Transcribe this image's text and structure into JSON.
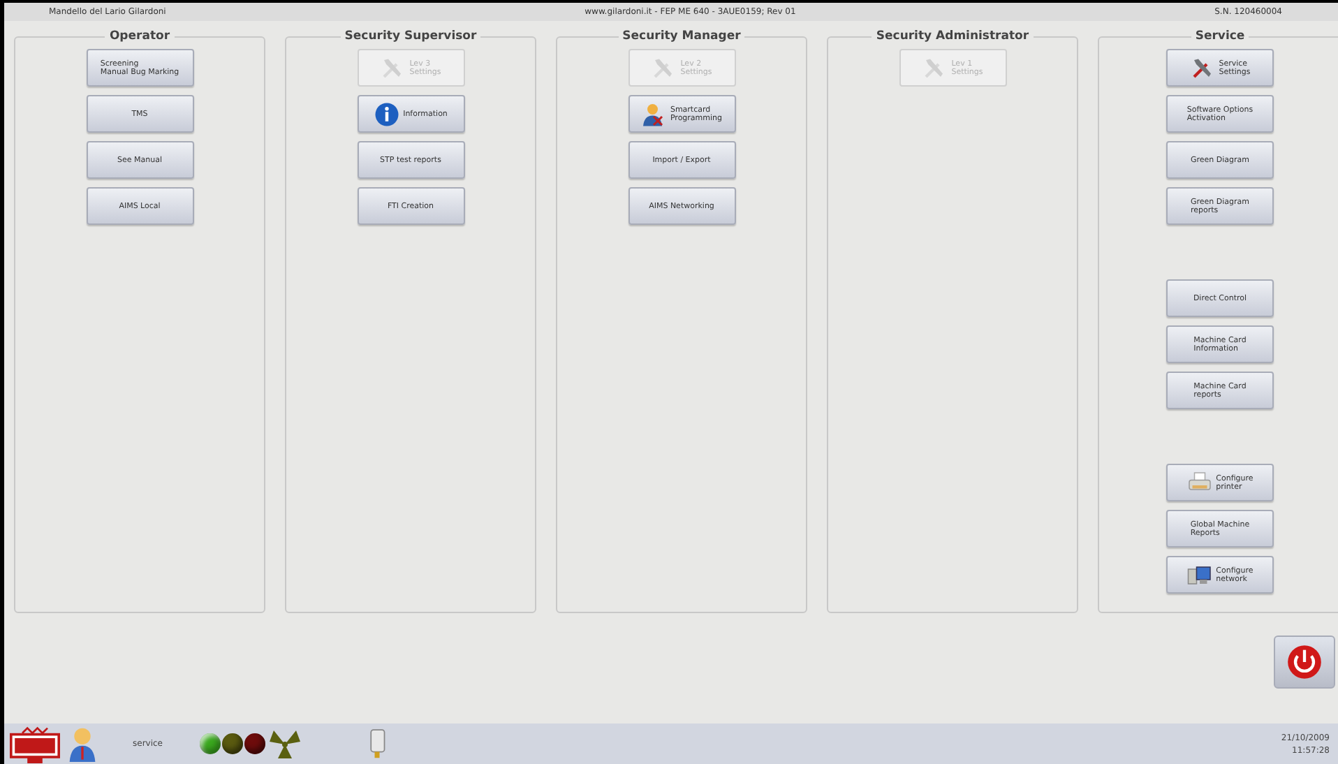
{
  "header": {
    "left": "Mandello del Lario Gilardoni",
    "center": "www.gilardoni.it - FEP ME 640 - 3AUE0159; Rev 01",
    "right": "S.N. 120460004"
  },
  "panels": [
    {
      "title": "Operator",
      "groups": [
        [
          {
            "label": "Screening\nManual Bug Marking",
            "disabled": false
          },
          {
            "label": "TMS",
            "disabled": false
          },
          {
            "label": "See Manual",
            "disabled": false
          },
          {
            "label": "AIMS Local",
            "disabled": false
          }
        ]
      ]
    },
    {
      "title": "Security Supervisor",
      "groups": [
        [
          {
            "label": "Lev 3\nSettings",
            "kind": "tools",
            "disabled": true
          },
          {
            "label": "Information",
            "kind": "info",
            "disabled": false
          },
          {
            "label": "STP test reports",
            "disabled": false
          },
          {
            "label": "FTI Creation",
            "disabled": false
          }
        ]
      ]
    },
    {
      "title": "Security Manager",
      "groups": [
        [
          {
            "label": "Lev 2\nSettings",
            "kind": "tools",
            "disabled": true
          },
          {
            "label": "Smartcard\nProgramming",
            "kind": "person",
            "disabled": false
          },
          {
            "label": "Import / Export",
            "disabled": false
          },
          {
            "label": "AIMS Networking",
            "disabled": false
          }
        ]
      ]
    },
    {
      "title": "Security Administrator",
      "groups": [
        [
          {
            "label": "Lev 1\nSettings",
            "kind": "tools",
            "disabled": true
          }
        ]
      ]
    },
    {
      "title": "Service",
      "groups": [
        [
          {
            "label": "Service\nSettings",
            "kind": "tools",
            "disabled": false
          },
          {
            "label": "Software Options\nActivation",
            "disabled": false
          },
          {
            "label": "Green Diagram",
            "disabled": false
          },
          {
            "label": "Green Diagram\nreports",
            "disabled": false
          }
        ],
        [
          {
            "label": "Direct Control",
            "disabled": false
          },
          {
            "label": "Machine Card\nInformation",
            "disabled": false
          },
          {
            "label": "Machine Card\nreports",
            "disabled": false
          }
        ],
        [
          {
            "label": "Configure\nprinter",
            "kind": "printer",
            "disabled": false
          },
          {
            "label": "Global Machine\nReports",
            "disabled": false
          },
          {
            "label": "Configure\nnetwork",
            "kind": "network",
            "disabled": false
          }
        ]
      ]
    }
  ],
  "status_bar": {
    "user": "service",
    "lights": [
      {
        "on": true,
        "color": "#3aa81e"
      },
      {
        "on": false,
        "color": "#5a5a10"
      },
      {
        "on": false,
        "color": "#6e0c0c"
      }
    ],
    "date": "21/10/2009",
    "time": "11:57:28"
  }
}
